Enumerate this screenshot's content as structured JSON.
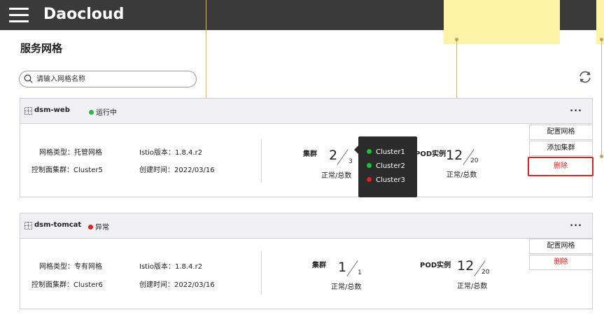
{
  "app": {
    "brand": "Daocloud"
  },
  "page": {
    "title": "服务网格"
  },
  "search": {
    "placeholder": "请输入网格名称"
  },
  "colors": {
    "running": "#22c03a",
    "error": "#e02020",
    "danger": "#e02020"
  },
  "meshes": [
    {
      "name": "dsm-web",
      "status": "运行中",
      "mesh_type": "网格类型：托管网格",
      "control_cluster": "控制面集群：Cluster5",
      "istio_version": "Istio版本：1.8.4.r2",
      "created": "创建时间：2022/03/16",
      "cluster_label": "集群",
      "cluster_normal": "2",
      "cluster_total": "3",
      "pod_label": "POD实例",
      "pod_normal": "12",
      "pod_total": "20",
      "caption": "正常/总数",
      "actions": {
        "config": "配置网格",
        "add_cluster": "添加集群",
        "delete": "删除"
      }
    },
    {
      "name": "dsm-tomcat",
      "status": "异常",
      "mesh_type": "网格类型：专有网格",
      "control_cluster": "控制面集群：Cluster6",
      "istio_version": "Istio版本：1.8.4.r2",
      "created": "创建时间：2022/03/16",
      "cluster_label": "集群",
      "cluster_normal": "1",
      "cluster_total": "1",
      "pod_label": "POD实例",
      "pod_normal": "12",
      "pod_total": "20",
      "caption": "正常/总数",
      "actions": {
        "config": "配置网格",
        "delete": "删除"
      }
    }
  ],
  "cluster_popover": {
    "items": [
      {
        "name": "Cluster1",
        "state": "normal"
      },
      {
        "name": "Cluster2",
        "state": "normal"
      },
      {
        "name": "Cluster3",
        "state": "error"
      }
    ]
  },
  "more_label": "..."
}
